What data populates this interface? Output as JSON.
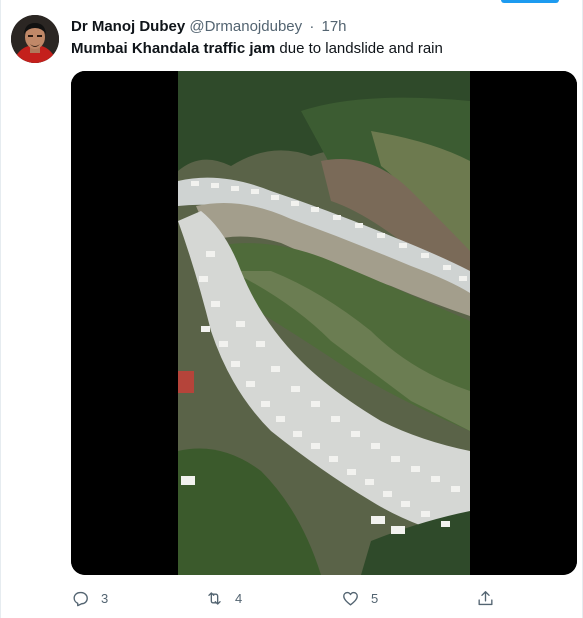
{
  "tweet": {
    "author_name": "Dr Manoj Dubey",
    "author_handle": "@Drmanojdubey",
    "separator": "·",
    "time": "17h",
    "text_bold": "Mumbai Khandala traffic jam",
    "text_rest": " due to landslide and rain",
    "media": {
      "type": "video",
      "description_icon": "video-frame"
    }
  },
  "actions": {
    "reply": {
      "icon": "reply-icon",
      "count": "3"
    },
    "retweet": {
      "icon": "retweet-icon",
      "count": "4"
    },
    "like": {
      "icon": "heart-icon",
      "count": "5"
    },
    "share": {
      "icon": "share-icon"
    }
  },
  "colors": {
    "text_primary": "#0f1419",
    "text_secondary": "#536471",
    "accent": "#1d9bf0",
    "media_background": "#000000"
  }
}
